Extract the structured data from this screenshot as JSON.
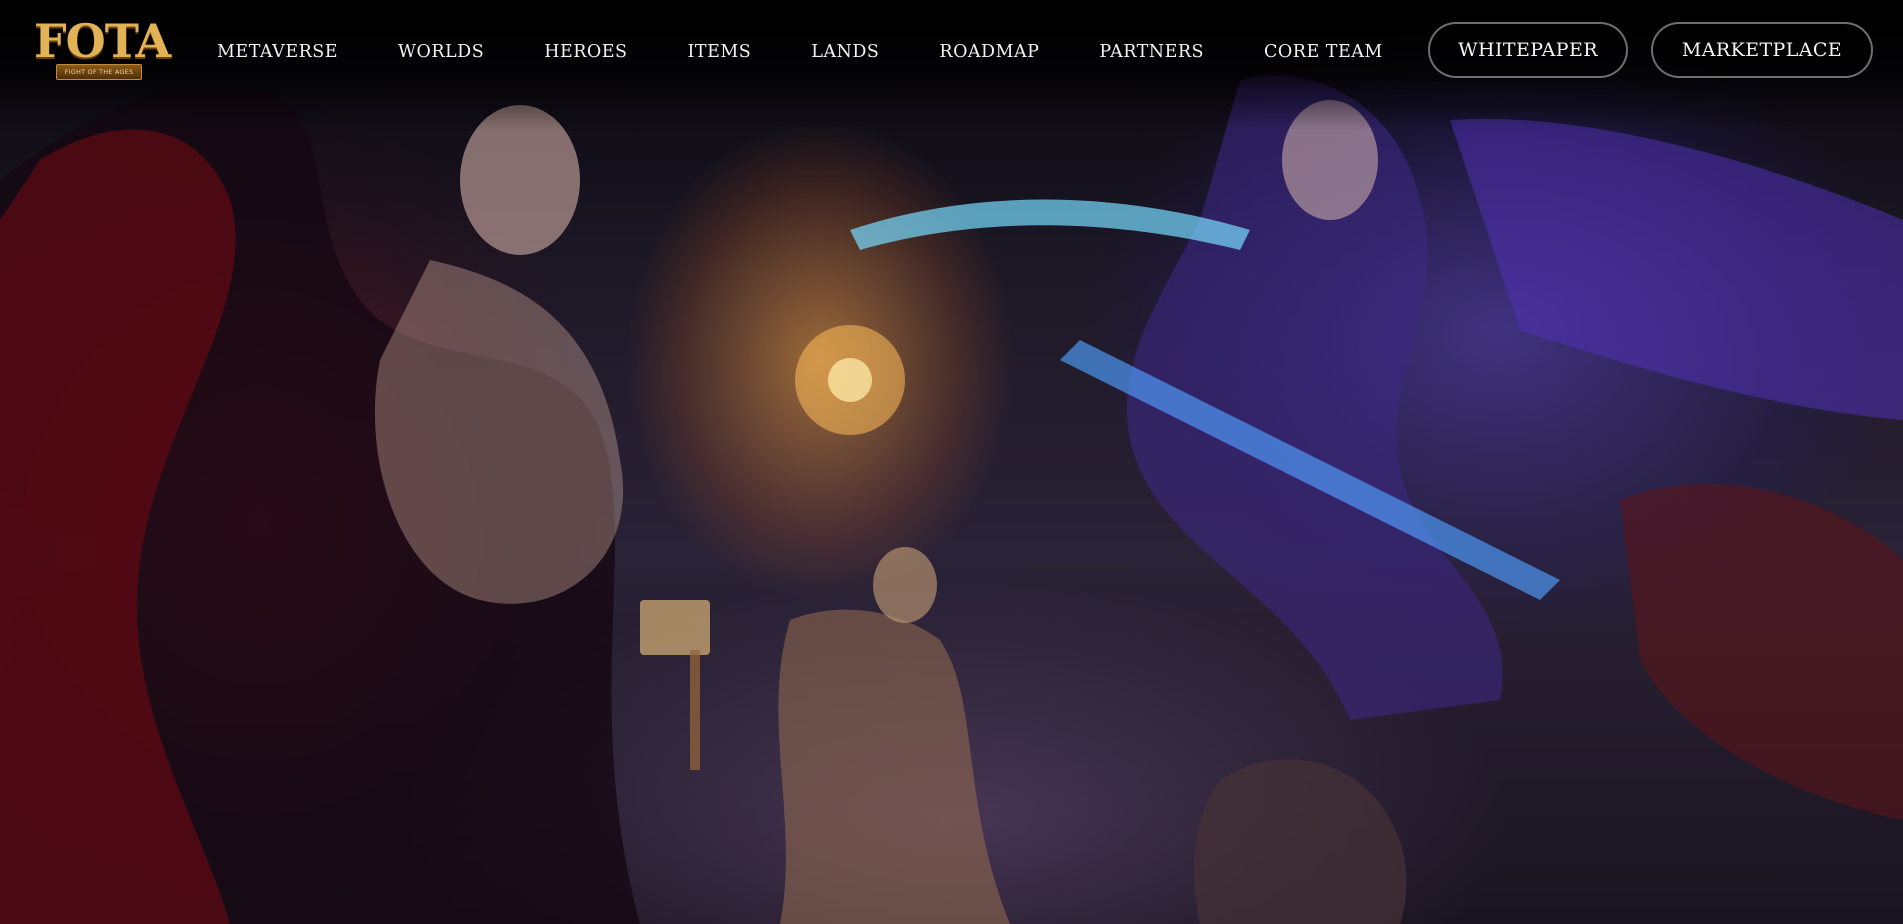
{
  "brand": {
    "logo_text": "FOTA",
    "logo_subtitle": "FIGHT OF THE AGES"
  },
  "nav": {
    "items": [
      {
        "label": "METAVERSE"
      },
      {
        "label": "WORLDS"
      },
      {
        "label": "HEROES"
      },
      {
        "label": "ITEMS"
      },
      {
        "label": "LANDS"
      },
      {
        "label": "ROADMAP"
      },
      {
        "label": "PARTNERS"
      },
      {
        "label": "CORE TEAM"
      }
    ]
  },
  "actions": {
    "whitepaper_label": "WHITEPAPER",
    "marketplace_label": "MARKETPLACE"
  },
  "hero": {
    "image_description_icon": "hero-artwork-image"
  },
  "colors": {
    "brand_gold": "#e2b256",
    "nav_text": "#f2f2f2",
    "button_border": "#c8c8c8",
    "page_bg": "#000000"
  }
}
